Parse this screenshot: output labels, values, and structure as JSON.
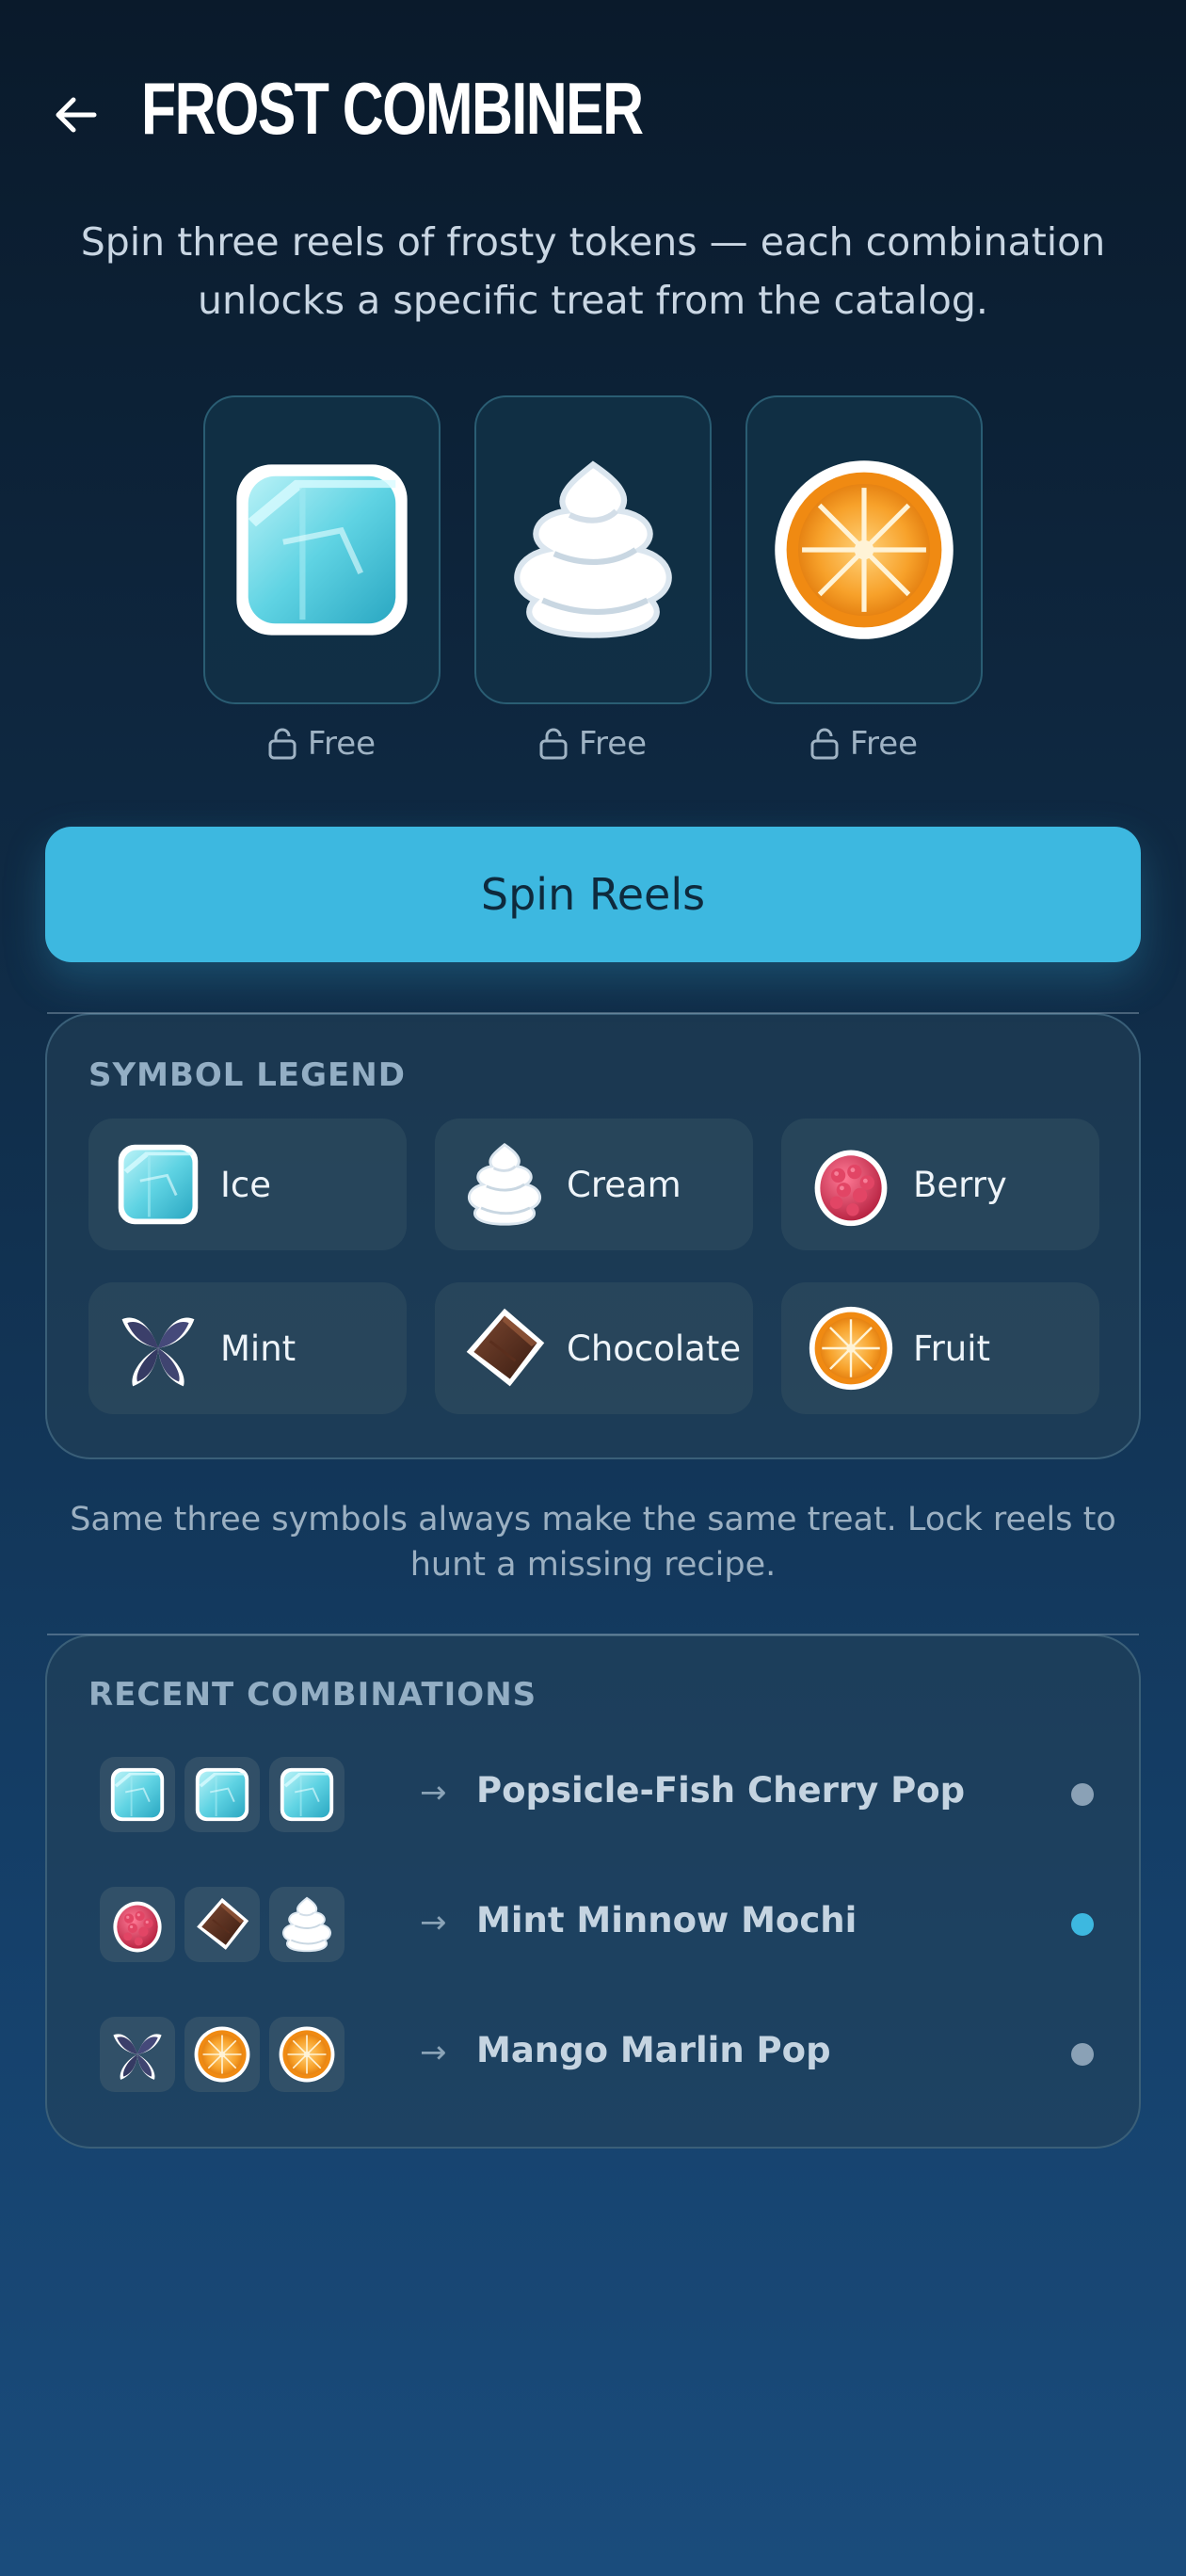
{
  "header": {
    "title": "FROST COMBINER",
    "back_icon": "back-arrow-icon"
  },
  "subtitle": "Spin three reels of frosty tokens — each combination unlocks a specific treat from the catalog.",
  "reels": [
    {
      "symbol": "ice",
      "lock_label": "Free"
    },
    {
      "symbol": "cream",
      "lock_label": "Free"
    },
    {
      "symbol": "fruit",
      "lock_label": "Free"
    }
  ],
  "spin_button": "Spin Reels",
  "legend": {
    "title": "SYMBOL LEGEND",
    "items": [
      {
        "label": "Ice",
        "icon": "ice-cube-icon"
      },
      {
        "label": "Cream",
        "icon": "cream-swirl-icon"
      },
      {
        "label": "Berry",
        "icon": "raspberry-icon"
      },
      {
        "label": "Mint",
        "icon": "mint-leaf-icon"
      },
      {
        "label": "Chocolate",
        "icon": "chocolate-icon"
      },
      {
        "label": "Fruit",
        "icon": "orange-slice-icon"
      }
    ]
  },
  "note": "Same three symbols always make the same treat. Lock reels to hunt a missing recipe.",
  "recent": {
    "title": "RECENT COMBINATIONS",
    "rows": [
      {
        "symbols": [
          "ice",
          "ice",
          "ice"
        ],
        "name": "Popsicle-Fish Cherry Pop",
        "status": "seen"
      },
      {
        "symbols": [
          "berry",
          "chocolate",
          "cream"
        ],
        "name": "Mint Minnow Mochi",
        "status": "new"
      },
      {
        "symbols": [
          "mint",
          "fruit",
          "fruit"
        ],
        "name": "Mango Marlin Pop",
        "status": "seen"
      }
    ]
  },
  "colors": {
    "accent": "#3db8e0",
    "background": "#0f2a44",
    "panel": "#254258"
  }
}
